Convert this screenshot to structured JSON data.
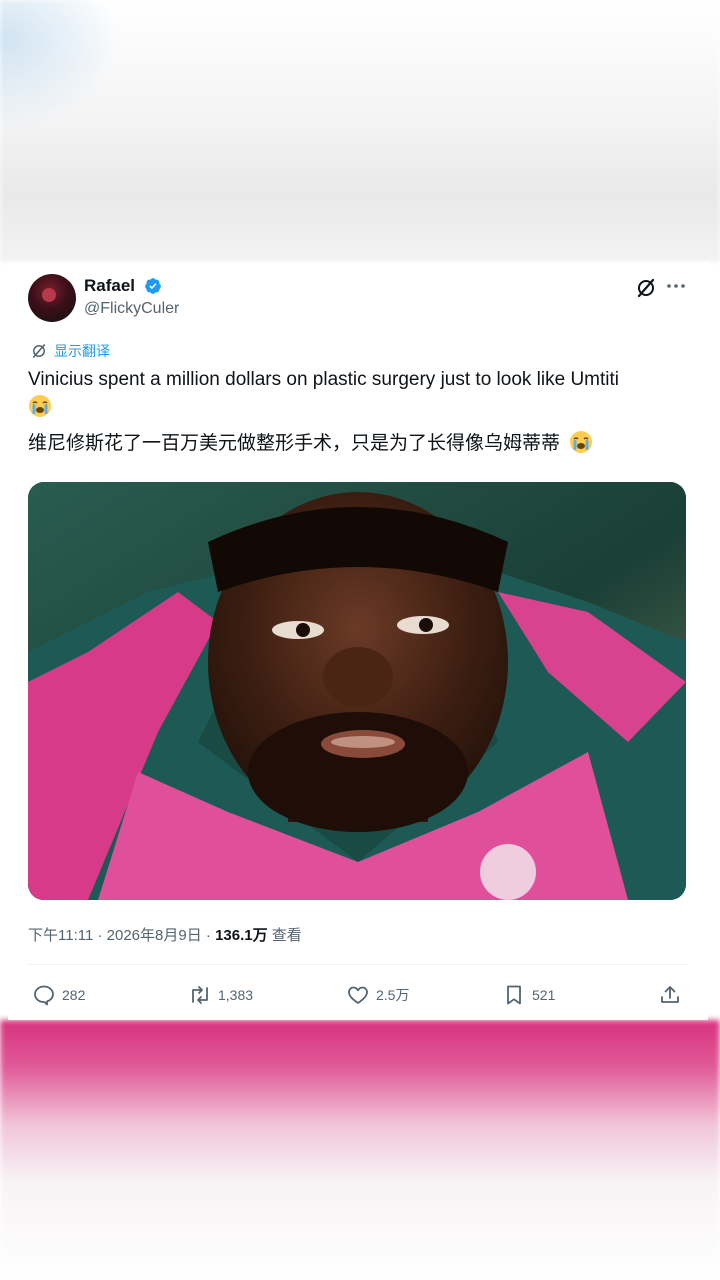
{
  "author": {
    "name": "Rafael",
    "handle": "@FlickyCuler",
    "verified_color": "#1d9bf0"
  },
  "translate_label": "显示翻译",
  "tweet": {
    "text_en": "Vinicius spent a million dollars on plastic surgery just to look like Umtiti",
    "text_zh": "维尼修斯花了一百万美元做整形手术，只是为了长得像乌姆蒂蒂",
    "emoji": "loudly-crying-face"
  },
  "meta": {
    "time": "下午11:11",
    "separator": "·",
    "date": "2026年8月9日",
    "views": "136.1万",
    "views_label": "查看"
  },
  "actions": {
    "replies": "282",
    "retweets": "1,383",
    "likes": "2.5万",
    "bookmarks": "521"
  },
  "colors": {
    "text": "#0f1419",
    "secondary": "#536471",
    "accent": "#1d9bf0"
  }
}
